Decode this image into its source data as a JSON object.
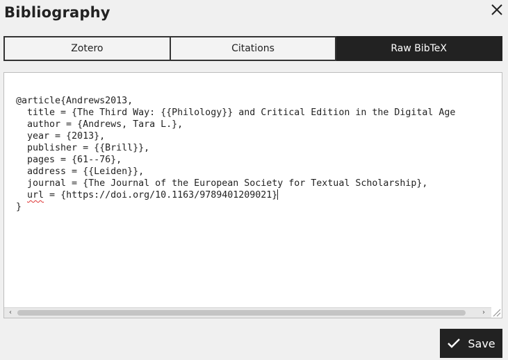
{
  "dialog": {
    "title": "Bibliography"
  },
  "tabs": [
    {
      "label": "Zotero",
      "active": false
    },
    {
      "label": "Citations",
      "active": false
    },
    {
      "label": "Raw BibTeX",
      "active": true
    }
  ],
  "editor": {
    "lines": {
      "l1": "@article{Andrews2013,",
      "l2": "  title = {The Third Way: {{Philology}} and Critical Edition in the Digital Age",
      "l3": "  author = {Andrews, Tara L.},",
      "l4": "  year = {2013},",
      "l5": "  publisher = {{Brill}},",
      "l6": "  pages = {61--76},",
      "l7": "  address = {{Leiden}},",
      "l8": "  journal = {The Journal of the European Society for Textual Scholarship},",
      "l9_indent": "  ",
      "l9_key": "url",
      "l9_rest": " = {https://doi.org/10.1163/9789401209021}",
      "l10": "}"
    }
  },
  "scrollbar": {
    "left_arrow": "‹",
    "right_arrow": "›"
  },
  "save": {
    "label": "Save",
    "icon": "checkmark-icon"
  },
  "close_icon": "close-icon"
}
